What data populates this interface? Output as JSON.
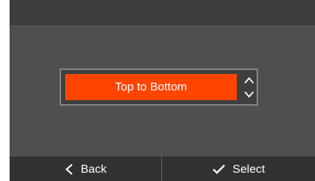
{
  "selector": {
    "value": "Top to Bottom",
    "up_icon": "chevron-up-icon",
    "down_icon": "chevron-down-icon"
  },
  "footer": {
    "back_label": "Back",
    "back_icon": "chevron-left-icon",
    "select_label": "Select",
    "select_icon": "checkmark-icon"
  },
  "colors": {
    "accent": "#ff4500",
    "background": "#4f4f4f",
    "header": "#3c3c3c",
    "footer": "#313131"
  }
}
